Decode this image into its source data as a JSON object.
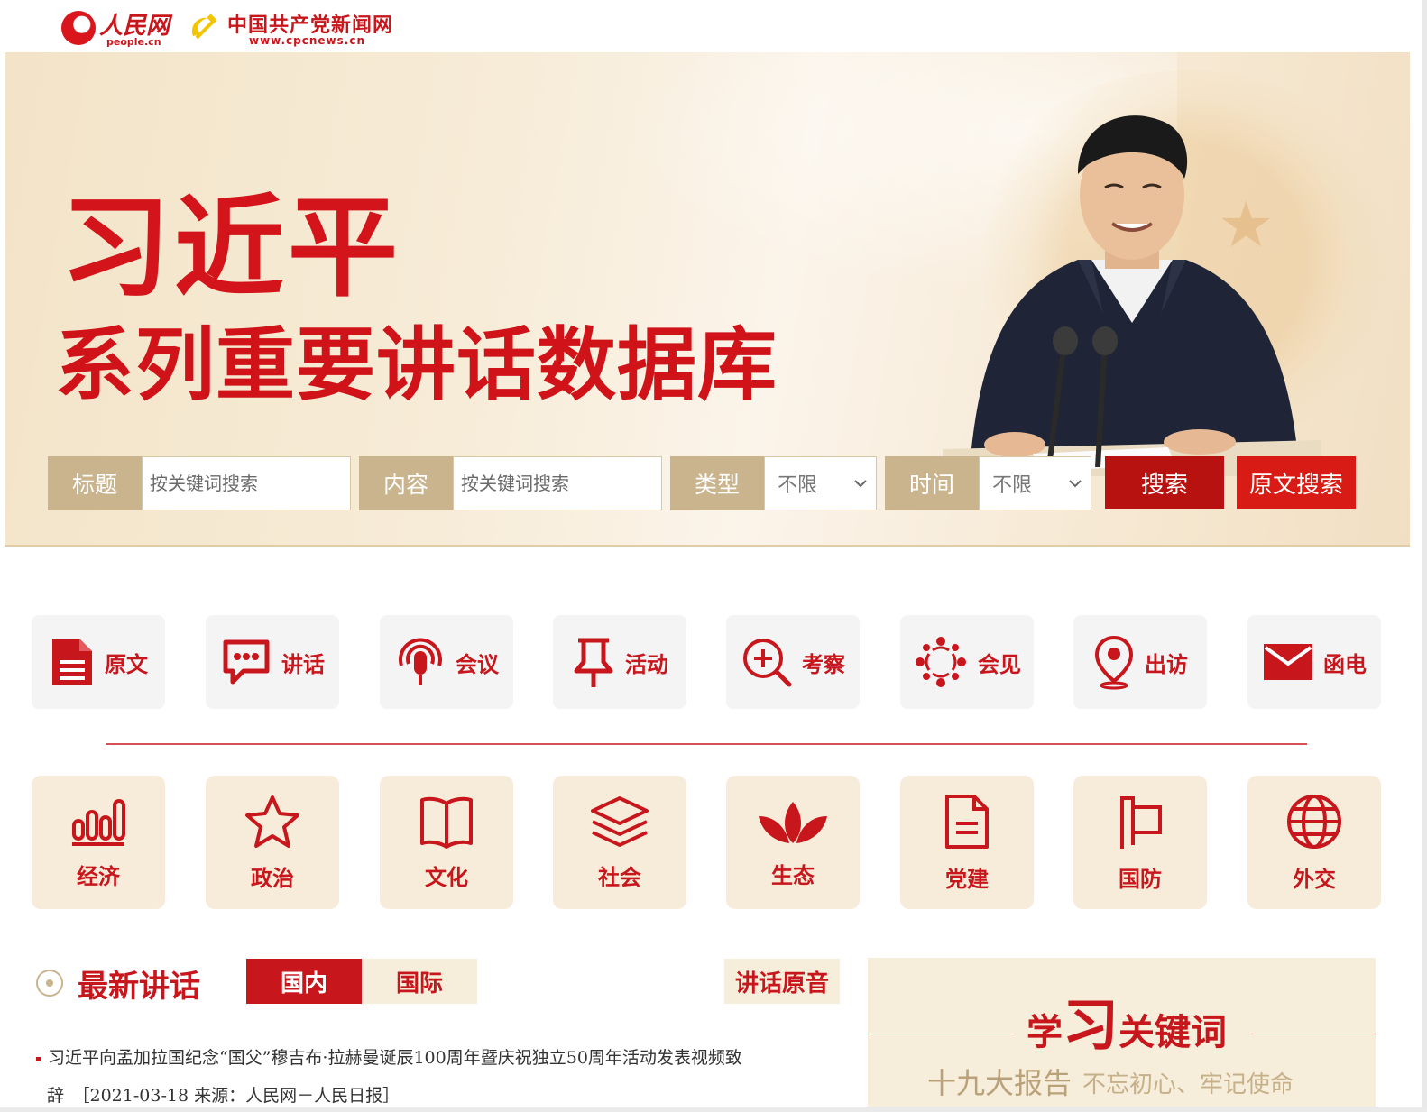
{
  "header": {
    "logo1": {
      "name": "人民网",
      "url": "people.cn"
    },
    "logo2": {
      "name": "中国共产党新闻网",
      "url": "www.cpcnews.cn"
    }
  },
  "banner": {
    "title_line1": "习近平",
    "title_line2": "系列重要讲话数据库"
  },
  "search": {
    "title_label": "标题",
    "title_placeholder": "按关键词搜索",
    "content_label": "内容",
    "content_placeholder": "按关键词搜索",
    "type_label": "类型",
    "type_value": "不限",
    "time_label": "时间",
    "time_value": "不限",
    "search_button": "搜索",
    "raw_search_button": "原文搜索"
  },
  "categories_row1": [
    {
      "label": "原文",
      "icon": "document-icon"
    },
    {
      "label": "讲话",
      "icon": "speech-bubble-icon"
    },
    {
      "label": "会议",
      "icon": "podcast-mic-icon"
    },
    {
      "label": "活动",
      "icon": "pushpin-icon"
    },
    {
      "label": "考察",
      "icon": "zoom-in-icon"
    },
    {
      "label": "会见",
      "icon": "people-circle-icon"
    },
    {
      "label": "出访",
      "icon": "location-pin-icon"
    },
    {
      "label": "函电",
      "icon": "envelope-icon"
    }
  ],
  "categories_row2": [
    {
      "label": "经济",
      "icon": "bar-chart-icon"
    },
    {
      "label": "政治",
      "icon": "star-icon"
    },
    {
      "label": "文化",
      "icon": "book-icon"
    },
    {
      "label": "社会",
      "icon": "layers-icon"
    },
    {
      "label": "生态",
      "icon": "leaves-icon"
    },
    {
      "label": "党建",
      "icon": "file-icon"
    },
    {
      "label": "国防",
      "icon": "flag-icon"
    },
    {
      "label": "外交",
      "icon": "globe-icon"
    }
  ],
  "latest": {
    "title": "最新讲话",
    "tab_domestic": "国内",
    "tab_international": "国际",
    "audio_link": "讲话原音",
    "items": [
      {
        "text": "习近平向孟加拉国纪念“国父”穆吉布·拉赫曼诞辰100周年暨庆祝独立50周年活动发表视频致",
        "cont": "辞　［2021-03-18  来源：人民网－人民日报］"
      }
    ]
  },
  "keywords": {
    "title_pre": "学",
    "title_big": "习",
    "title_post": "关键词",
    "item1": "十九大报告",
    "item2": "不忘初心、牢记使命"
  },
  "colors": {
    "brand_red": "#c8161d",
    "tan": "#c9b48d",
    "banner_bg": "#f6ead4"
  }
}
